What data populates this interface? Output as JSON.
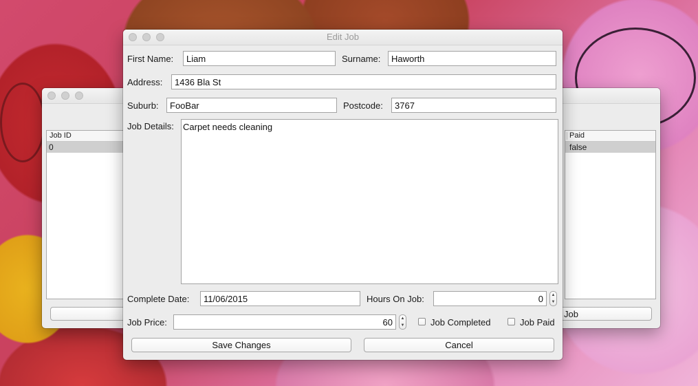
{
  "background_window": {
    "table": {
      "columns": [
        "Job ID",
        "Paid"
      ],
      "row": {
        "job_id": "0",
        "paid": "false"
      }
    },
    "right_button_label": "Job"
  },
  "dialog": {
    "title": "Edit Job",
    "first_name": {
      "label": "First Name:",
      "value": "Liam"
    },
    "surname": {
      "label": "Surname:",
      "value": "Haworth"
    },
    "address": {
      "label": "Address:",
      "value": "1436 Bla St"
    },
    "suburb": {
      "label": "Suburb:",
      "value": "FooBar"
    },
    "postcode": {
      "label": "Postcode:",
      "value": "3767"
    },
    "job_details": {
      "label": "Job Details:",
      "value": "Carpet needs cleaning"
    },
    "complete_date": {
      "label": "Complete Date:",
      "value": "11/06/2015"
    },
    "hours_on_job": {
      "label": "Hours On Job:",
      "value": "0"
    },
    "job_price": {
      "label": "Job Price:",
      "value": "60"
    },
    "job_completed": {
      "label": "Job Completed",
      "checked": false
    },
    "job_paid": {
      "label": "Job Paid",
      "checked": false
    },
    "save_label": "Save Changes",
    "cancel_label": "Cancel"
  }
}
